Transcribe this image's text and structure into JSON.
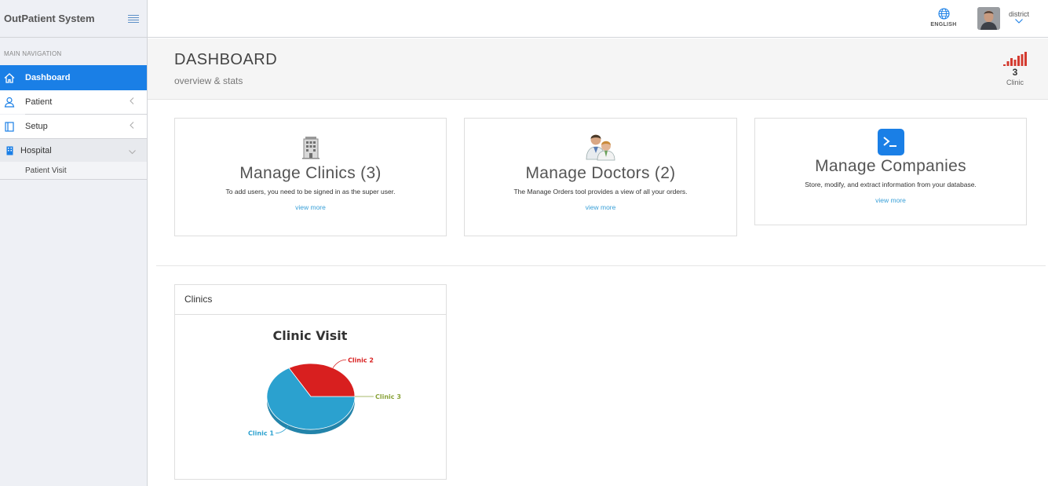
{
  "sidebar": {
    "brand": "OutPatient System",
    "nav_header": "MAIN NAVIGATION",
    "items": [
      {
        "label": "Dashboard",
        "icon": "home-icon"
      },
      {
        "label": "Patient",
        "icon": "user-icon"
      },
      {
        "label": "Setup",
        "icon": "book-icon"
      },
      {
        "label": "Hospital",
        "icon": "building-icon"
      }
    ],
    "sub_items": [
      {
        "label": "Patient Visit"
      }
    ]
  },
  "topbar": {
    "language": "ENGLISH",
    "username": "district"
  },
  "header": {
    "title": "DASHBOARD",
    "subtitle": "overview & stats",
    "stat_value": "3",
    "stat_label": "Clinic"
  },
  "cards": [
    {
      "title": "Manage Clinics (3)",
      "description": "To add users, you need to be signed in as the super user.",
      "link": "view more",
      "icon": "hospital-building-icon"
    },
    {
      "title": "Manage Doctors (2)",
      "description": "The Manage Orders tool provides a view of all your orders.",
      "link": "view more",
      "icon": "doctors-icon"
    },
    {
      "title": "Manage Companies",
      "description": "Store, modify, and extract information from your database.",
      "link": "view more",
      "icon": "terminal-icon"
    }
  ],
  "clinics_panel": {
    "heading": "Clinics"
  },
  "colors": {
    "accent": "#1a7fe6",
    "link": "#3aa0d8",
    "clinic1": "#2ba1cf",
    "clinic2": "#d81f1f",
    "clinic3": "#8aa33a"
  },
  "chart_data": {
    "type": "pie",
    "title": "Clinic Visit",
    "labels": [
      "Clinic 1",
      "Clinic 2",
      "Clinic 3"
    ],
    "values": [
      66.7,
      33.3,
      0
    ],
    "colors": [
      "#2ba1cf",
      "#d81f1f",
      "#8aa33a"
    ]
  }
}
